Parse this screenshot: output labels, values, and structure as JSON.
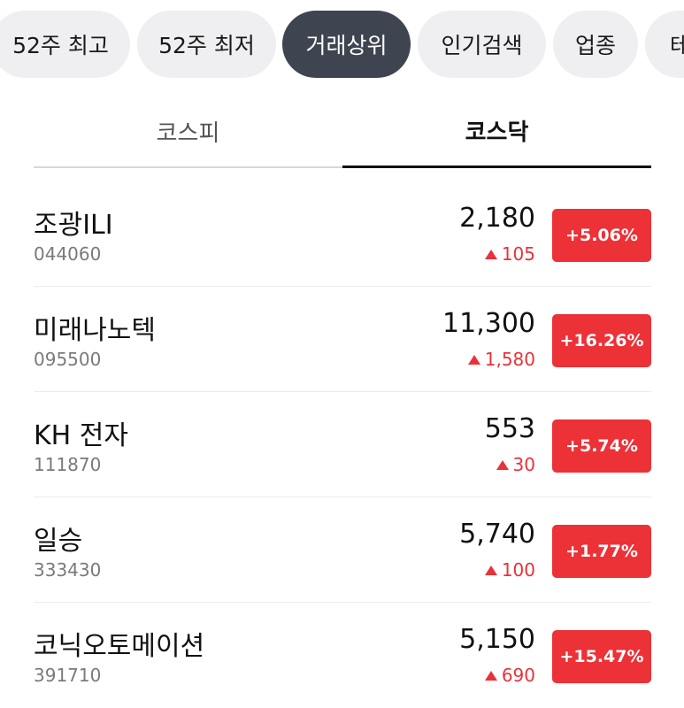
{
  "chips": [
    {
      "label": "52주 최고",
      "active": false
    },
    {
      "label": "52주 최저",
      "active": false
    },
    {
      "label": "거래상위",
      "active": true
    },
    {
      "label": "인기검색",
      "active": false
    },
    {
      "label": "업종",
      "active": false
    },
    {
      "label": "테",
      "active": false
    }
  ],
  "market_tabs": {
    "kospi": "코스피",
    "kosdaq": "코스닥",
    "selected": "kosdaq"
  },
  "colors": {
    "up": "#e8323a",
    "badge": "#ec3137",
    "active_chip": "#3f4550"
  },
  "stocks": [
    {
      "name": "조광ILI",
      "code": "044060",
      "price": "2,180",
      "change": "105",
      "pct": "+5.06%"
    },
    {
      "name": "미래나노텍",
      "code": "095500",
      "price": "11,300",
      "change": "1,580",
      "pct": "+16.26%"
    },
    {
      "name": "KH 전자",
      "code": "111870",
      "price": "553",
      "change": "30",
      "pct": "+5.74%"
    },
    {
      "name": "일승",
      "code": "333430",
      "price": "5,740",
      "change": "100",
      "pct": "+1.77%"
    },
    {
      "name": "코닉오토메이션",
      "code": "391710",
      "price": "5,150",
      "change": "690",
      "pct": "+15.47%"
    }
  ]
}
